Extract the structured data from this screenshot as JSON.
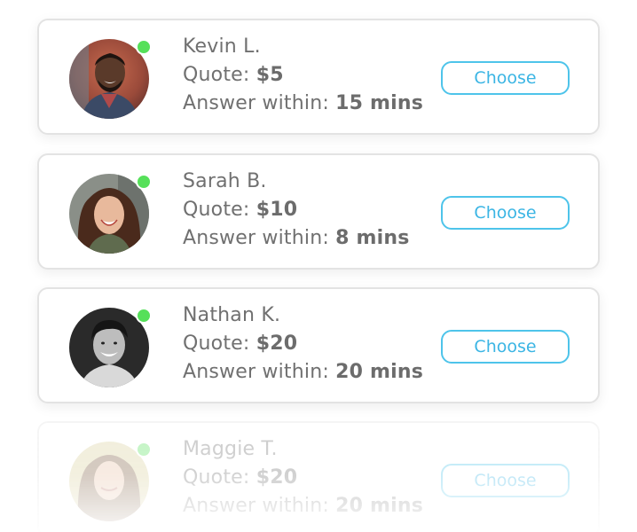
{
  "experts": [
    {
      "name": "Kevin L.",
      "quote_label": "Quote:",
      "quote_value": "$5",
      "answer_label": "Answer within:",
      "answer_value": "15 mins",
      "choose_label": "Choose",
      "online": true,
      "avatar": "man-with-beard-photo"
    },
    {
      "name": "Sarah B.",
      "quote_label": "Quote:",
      "quote_value": "$10",
      "answer_label": "Answer within:",
      "answer_value": "8 mins",
      "choose_label": "Choose",
      "online": true,
      "avatar": "woman-curly-hair-photo"
    },
    {
      "name": "Nathan K.",
      "quote_label": "Quote:",
      "quote_value": "$20",
      "answer_label": "Answer within:",
      "answer_value": "20 mins",
      "choose_label": "Choose",
      "online": true,
      "avatar": "young-man-bw-photo"
    },
    {
      "name": "Maggie T.",
      "quote_label": "Quote:",
      "quote_value": "$20",
      "answer_label": "Answer within:",
      "answer_value": "20 mins",
      "choose_label": "Choose",
      "online": true,
      "avatar": "woman-long-hair-photo"
    }
  ],
  "colors": {
    "online_dot": "#56e05a",
    "accent": "#3bb5e4",
    "text": "#707070",
    "card_border": "#e3e3e3"
  }
}
